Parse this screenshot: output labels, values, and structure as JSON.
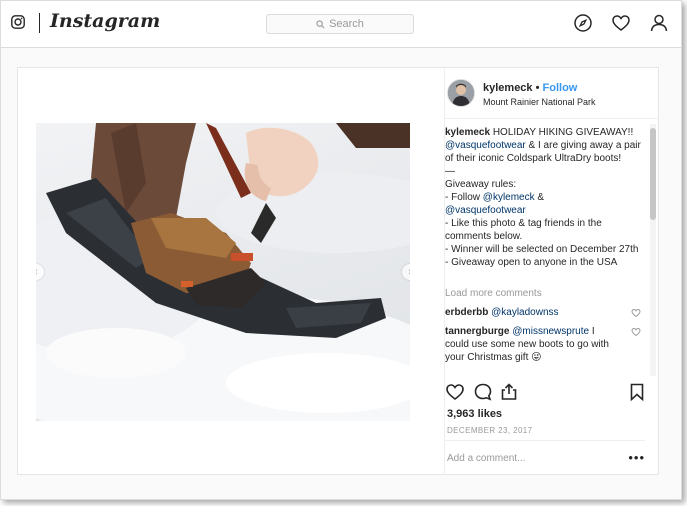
{
  "app": {
    "logo_text": "Instagram"
  },
  "search": {
    "placeholder": "Search"
  },
  "nav": {
    "icons": [
      "camera-icon",
      "compass-icon",
      "heart-icon",
      "profile-icon"
    ]
  },
  "post": {
    "username": "kylemeck",
    "follow_label": "Follow",
    "separator": "•",
    "location": "Mount Rainier National Park",
    "caption": {
      "author": "kylemeck",
      "text1": "HOLIDAY HIKING GIVEAWAY!!",
      "mention1": "@vasquefootwear",
      "text2": "& I are giving away a pair of their iconic Coldspark UltraDry boots!",
      "rule_dash": "—",
      "rules_title": "Giveaway rules:",
      "rule1_prefix": "- Follow",
      "rule1_mention_a": "@kylemeck",
      "rule1_and": "&",
      "rule1_mention_b": "@vasquefootwear",
      "rule2": "- Like this photo & tag friends in the comments below.",
      "rule3": "- Winner will be selected on December 27th",
      "rule4": "- Giveaway open to anyone in the USA"
    },
    "load_more": "Load more comments",
    "comments": [
      {
        "user": "erbderbb",
        "mention": "@kayladownss",
        "text": ""
      },
      {
        "user": "tannergburge",
        "mention": "@missnewsprute",
        "text": "I could use some new boots to go with your Christmas gift",
        "emoji": "😜"
      }
    ],
    "likes": "3,963 likes",
    "date": "DECEMBER 23, 2017",
    "add_comment_placeholder": "Add a comment...",
    "more_label": "•••"
  },
  "colors": {
    "link": "#003569",
    "follow": "#3897f0",
    "muted": "#999999"
  }
}
